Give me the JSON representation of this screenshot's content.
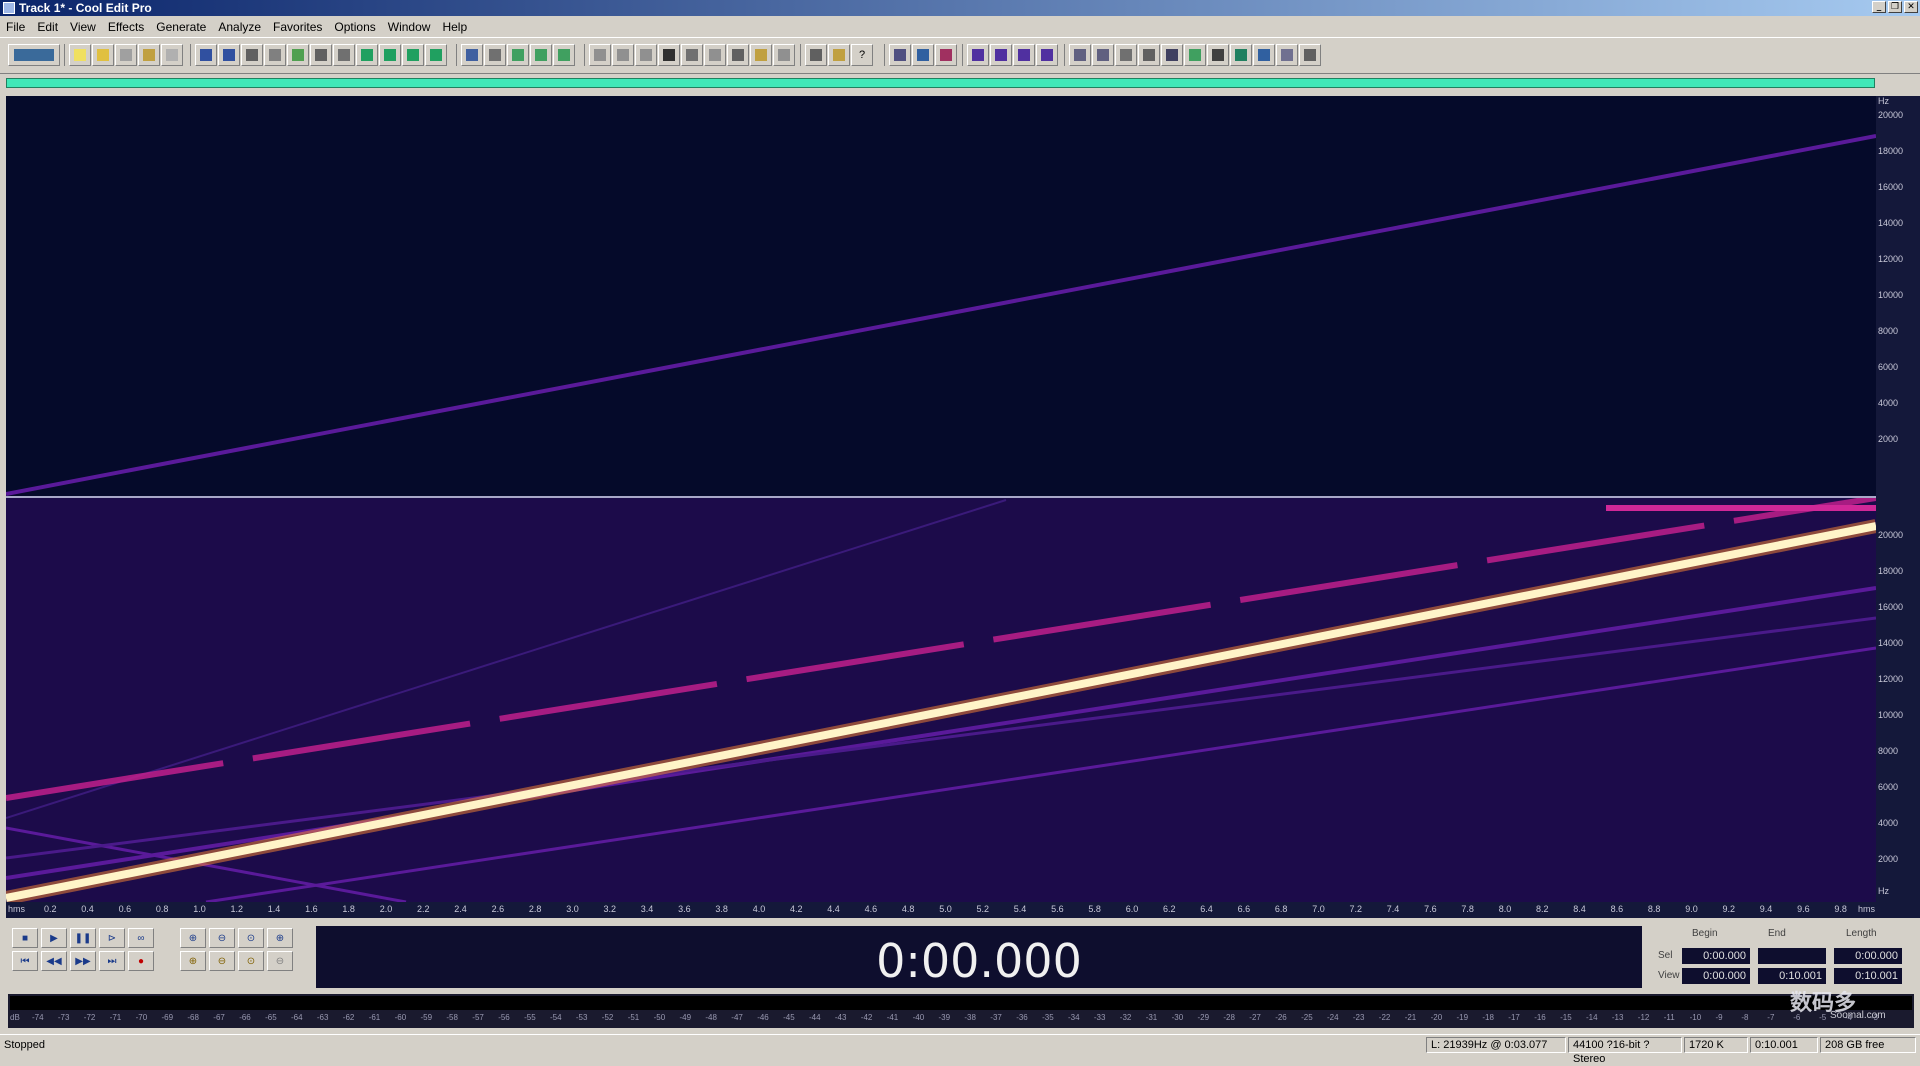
{
  "window": {
    "title": "Track 1* - Cool Edit Pro"
  },
  "menu": {
    "items": [
      "File",
      "Edit",
      "View",
      "Effects",
      "Generate",
      "Analyze",
      "Favorites",
      "Options",
      "Window",
      "Help"
    ]
  },
  "ruler": {
    "hz_unit": "Hz",
    "top_hz_ticks": [
      "20000",
      "18000",
      "16000",
      "14000",
      "12000",
      "10000",
      "8000",
      "6000",
      "4000",
      "2000"
    ],
    "bottom_hz_ticks": [
      "20000",
      "18000",
      "16000",
      "14000",
      "12000",
      "10000",
      "8000",
      "6000",
      "4000",
      "2000"
    ],
    "bottom_hz_unit": "Hz",
    "time_start": "hms",
    "time_end": "hms",
    "time_ticks": [
      "0.2",
      "0.4",
      "0.6",
      "0.8",
      "1.0",
      "1.2",
      "1.4",
      "1.6",
      "1.8",
      "2.0",
      "2.2",
      "2.4",
      "2.6",
      "2.8",
      "3.0",
      "3.2",
      "3.4",
      "3.6",
      "3.8",
      "4.0",
      "4.2",
      "4.4",
      "4.6",
      "4.8",
      "5.0",
      "5.2",
      "5.4",
      "5.6",
      "5.8",
      "6.0",
      "6.2",
      "6.4",
      "6.6",
      "6.8",
      "7.0",
      "7.2",
      "7.4",
      "7.6",
      "7.8",
      "8.0",
      "8.2",
      "8.4",
      "8.6",
      "8.8",
      "9.0",
      "9.2",
      "9.4",
      "9.6",
      "9.8"
    ]
  },
  "transport": {
    "time_display": "0:00.000"
  },
  "selection": {
    "begin_label": "Begin",
    "end_label": "End",
    "length_label": "Length",
    "sel_label": "Sel",
    "view_label": "View",
    "sel_begin": "0:00.000",
    "sel_end": "",
    "sel_length": "0:00.000",
    "view_begin": "0:00.000",
    "view_end": "0:10.001",
    "view_length": "0:10.001"
  },
  "level_meter": {
    "start": "dB",
    "ticks": [
      "-74",
      "-73",
      "-72",
      "-71",
      "-70",
      "-69",
      "-68",
      "-67",
      "-66",
      "-65",
      "-64",
      "-63",
      "-62",
      "-61",
      "-60",
      "-59",
      "-58",
      "-57",
      "-56",
      "-55",
      "-54",
      "-53",
      "-52",
      "-51",
      "-50",
      "-49",
      "-48",
      "-47",
      "-46",
      "-45",
      "-44",
      "-43",
      "-42",
      "-41",
      "-40",
      "-39",
      "-38",
      "-37",
      "-36",
      "-35",
      "-34",
      "-33",
      "-32",
      "-31",
      "-30",
      "-29",
      "-28",
      "-27",
      "-26",
      "-25",
      "-24",
      "-23",
      "-22",
      "-21",
      "-20",
      "-19",
      "-18",
      "-17",
      "-16",
      "-15",
      "-14",
      "-13",
      "-12",
      "-11",
      "-10",
      "-9",
      "-8",
      "-7",
      "-6",
      "-5",
      "-4",
      "-3"
    ]
  },
  "status": {
    "state": "Stopped",
    "cursor": "L: 21939Hz @   0:03.077",
    "format": "44100 ?16-bit ?Stereo",
    "size": "1720 K",
    "duration": "0:10.001",
    "free": "208 GB free"
  },
  "watermark": {
    "main": "数码多",
    "sub": "Soomal.com"
  },
  "colors": {
    "progress": "#40e8b8",
    "spectrum_bg_top": "#050a2a",
    "spectrum_bg_bottom": "#1c0b4a",
    "sweep_bright": "#fff4c8",
    "harmonic": "#c0208c",
    "sweep_dim": "#5a1a9a"
  }
}
